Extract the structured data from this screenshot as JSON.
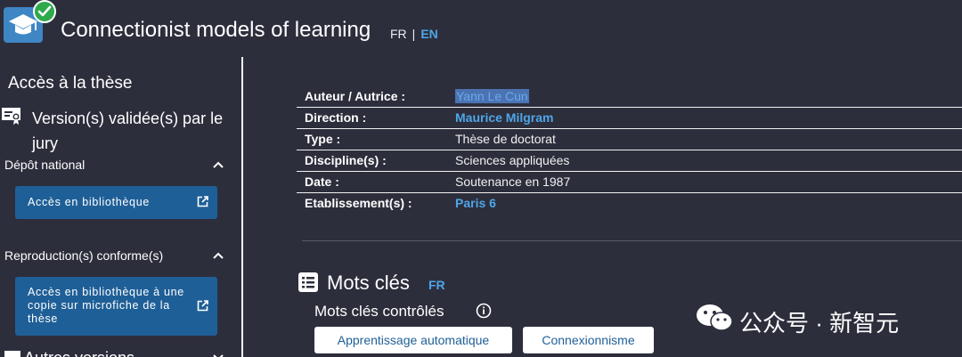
{
  "header": {
    "title": "Connectionist models of learning",
    "lang_fr": "FR",
    "lang_sep": "|",
    "lang_en": "EN"
  },
  "sidebar": {
    "heading": "Accès à la thèse",
    "version_label": "Version(s) validée(s) par le jury",
    "depot_label": "Dépôt national",
    "depot_button": "Accès en bibliothèque",
    "repro_label": "Reproduction(s) conforme(s)",
    "repro_button": "Accès en bibliothèque à une copie sur microfiche de la thèse",
    "other_label": "Autres versions"
  },
  "info": {
    "rows": [
      {
        "key": "Auteur / Autrice :",
        "value": "Yann Le Cun"
      },
      {
        "key": "Direction :",
        "value": "Maurice Milgram"
      },
      {
        "key": "Type :",
        "value": "Thèse de doctorat"
      },
      {
        "key": "Discipline(s) :",
        "value": "Sciences appliquées"
      },
      {
        "key": "Date :",
        "value": "Soutenance en 1987"
      },
      {
        "key": "Etablissement(s) :",
        "value": "Paris 6"
      }
    ]
  },
  "keywords": {
    "title": "Mots clés",
    "lang": "FR",
    "subtitle": "Mots clés contrôlés",
    "tags": [
      "Apprentissage automatique",
      "Connexionnisme"
    ]
  },
  "watermark": {
    "text": "公众号 · 新智元"
  },
  "colors": {
    "background": "#2d2e3c",
    "accent": "#4fa6e8",
    "button": "#1f5f97",
    "check": "#2eaa4d"
  }
}
